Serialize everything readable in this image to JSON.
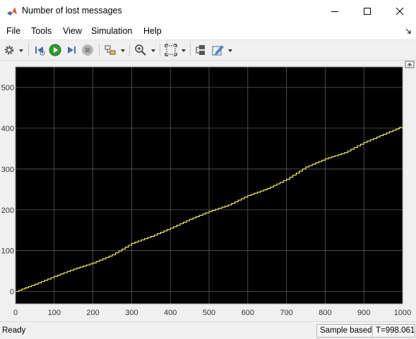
{
  "window": {
    "title": "Number of lost messages",
    "minimize_glyph": "—",
    "maximize_glyph": "☐",
    "close_glyph": "✕"
  },
  "menu": {
    "items": [
      "File",
      "Tools",
      "View",
      "Simulation",
      "Help"
    ]
  },
  "toolbar": {
    "icons": [
      "gear-icon",
      "step-back-icon",
      "run-icon",
      "step-forward-icon",
      "stop-icon",
      "highlight-block-icon",
      "zoom-icon",
      "autoscale-icon",
      "signal-select-icon",
      "edit-icon"
    ]
  },
  "status": {
    "left": "Ready",
    "mode": "Sample based",
    "time": "T=998.061"
  },
  "colors": {
    "plot_background": "#000000",
    "grid": "#5a5a5a",
    "line": "#ffff66",
    "run_button": "#2e9c2e"
  },
  "chart_data": {
    "type": "line",
    "title": "",
    "xlabel": "",
    "ylabel": "",
    "xlim": [
      0,
      1000
    ],
    "ylim": [
      -30,
      550
    ],
    "xticks": [
      0,
      100,
      200,
      300,
      400,
      500,
      600,
      700,
      800,
      900,
      1000
    ],
    "yticks": [
      0,
      100,
      200,
      300,
      400,
      500
    ],
    "grid": true,
    "series": [
      {
        "x": [
          0,
          50,
          100,
          150,
          200,
          250,
          300,
          350,
          400,
          450,
          500,
          550,
          600,
          650,
          700,
          750,
          800,
          850,
          900,
          950,
          1000
        ],
        "y": [
          0,
          18,
          37,
          55,
          70,
          90,
          118,
          135,
          155,
          177,
          196,
          212,
          235,
          252,
          275,
          305,
          325,
          340,
          365,
          385,
          405
        ]
      }
    ]
  }
}
